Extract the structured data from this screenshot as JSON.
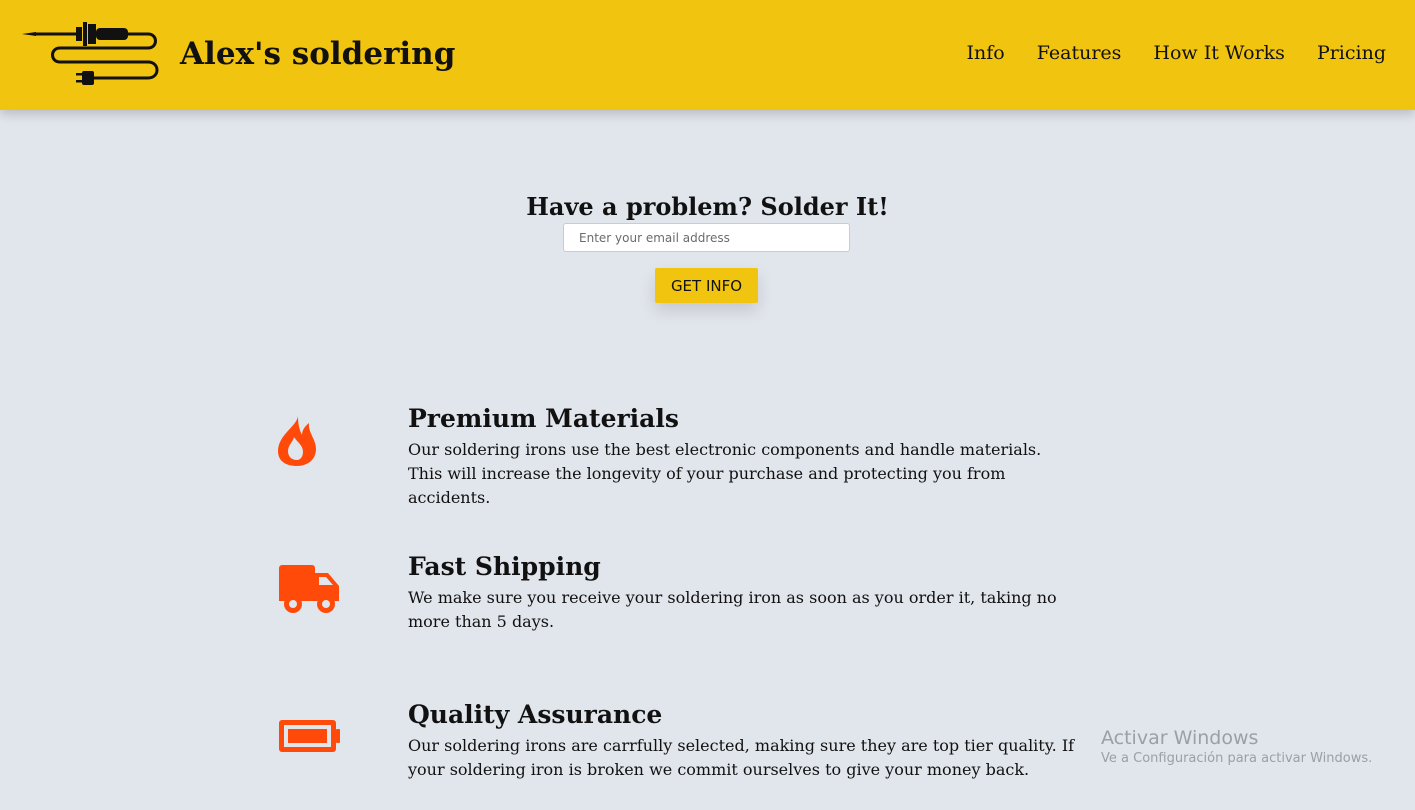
{
  "header": {
    "brand": "Alex's soldering",
    "logo_icon": "soldering-iron-icon",
    "nav": [
      "Info",
      "Features",
      "How It Works",
      "Pricing"
    ]
  },
  "hero": {
    "title": "Have a problem? Solder It!",
    "email_placeholder": "Enter your email address",
    "button_label": "GET INFO"
  },
  "features": [
    {
      "icon": "flame-icon",
      "title": "Premium Materials",
      "text": "Our soldering irons use the best electronic components and handle materials. This will increase the longevity of your purchase and protecting you from accidents."
    },
    {
      "icon": "truck-icon",
      "title": "Fast Shipping",
      "text": "We make sure you receive your soldering iron as soon as you order it, taking no more than 5 days."
    },
    {
      "icon": "battery-icon",
      "title": "Quality Assurance",
      "text": "Our soldering irons are carrfully selected, making sure they are top tier quality. If your soldering iron is broken we commit ourselves to give your money back."
    }
  ],
  "watermark": {
    "title": "Activar Windows",
    "subtitle": "Ve a Configuración para activar Windows."
  },
  "colors": {
    "header_bg": "#f1c40f",
    "page_bg": "#e1e5ec",
    "icon_accent": "#ff4a0a"
  }
}
